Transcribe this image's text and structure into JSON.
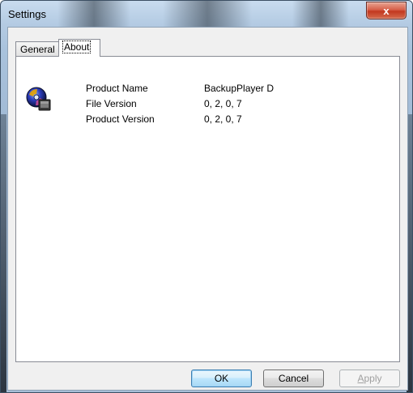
{
  "window": {
    "title": "Settings",
    "close_label": "x"
  },
  "tabs": [
    {
      "label": "General",
      "selected": false
    },
    {
      "label": "About",
      "selected": true
    }
  ],
  "about": {
    "icon": "media-disc-icon",
    "rows": [
      {
        "label": "Product Name",
        "value": "BackupPlayer D"
      },
      {
        "label": "File Version",
        "value": "0, 2, 0, 7"
      },
      {
        "label": "Product Version",
        "value": "0, 2, 0, 7"
      }
    ]
  },
  "buttons": {
    "ok": "OK",
    "cancel": "Cancel",
    "apply_first": "A",
    "apply_rest": "pply",
    "apply_enabled": false
  }
}
